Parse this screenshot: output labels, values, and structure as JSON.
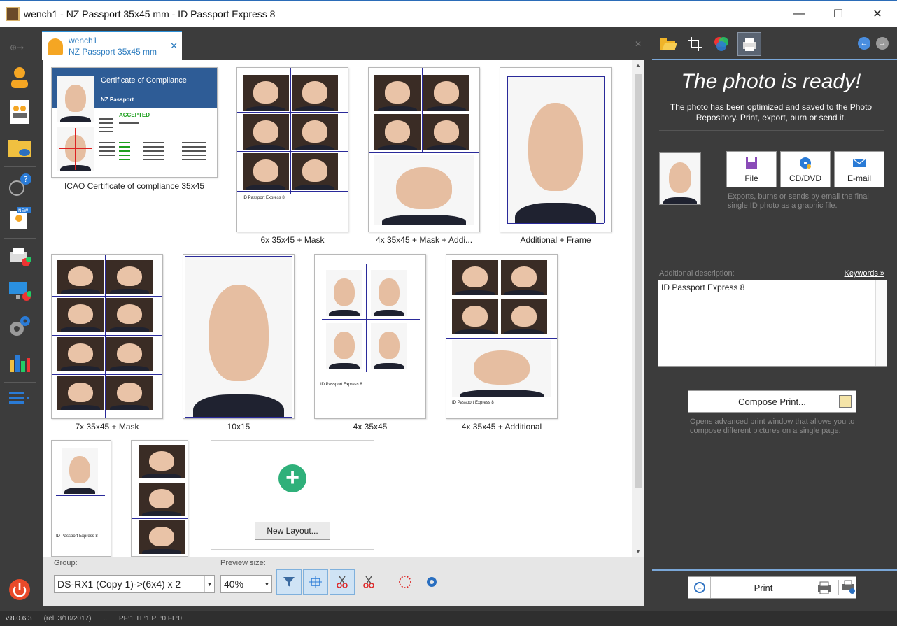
{
  "window": {
    "title": "wench1 - NZ Passport 35x45 mm - ID Passport Express 8",
    "minimize": "—",
    "maximize": "☐",
    "close": "✕"
  },
  "tab": {
    "line1": "wench1",
    "line2": "NZ Passport 35x45 mm",
    "close": "✕"
  },
  "layouts": [
    {
      "caption": "ICAO Certificate of compliance 35x45"
    },
    {
      "caption": "6x 35x45 + Mask"
    },
    {
      "caption": "4x 35x45 + Mask + Addi..."
    },
    {
      "caption": "Additional + Frame"
    },
    {
      "caption": "7x 35x45 + Mask"
    },
    {
      "caption": "10x15"
    },
    {
      "caption": "4x 35x45"
    },
    {
      "caption": "4x 35x45 + Additional"
    }
  ],
  "certificate": {
    "title": "Certificate of Compliance",
    "subtitle": "NZ Passport",
    "status": "ACCEPTED"
  },
  "print_label_small": "ID Passport Express 8",
  "new_layout_button": "New Layout...",
  "bottom_toolbar": {
    "group_label": "Group:",
    "group_value": "DS-RX1 (Copy 1)->(6x4) x 2",
    "preview_label": "Preview size:",
    "preview_value": "40%"
  },
  "right_panel": {
    "title": "The photo is ready!",
    "text": "The photo has been optimized and saved to the Photo Repository. Print, export, burn or send it.",
    "export_buttons": [
      "File",
      "CD/DVD",
      "E-mail"
    ],
    "export_note": "Exports, burns or sends by email the final single ID photo as a graphic file.",
    "additional_description_label": "Additional description:",
    "keywords_link": "Keywords »",
    "description_value": "ID Passport Express 8",
    "compose_button": "Compose Print...",
    "compose_note": "Opens advanced print window that allows you to compose different pictures on a single page.",
    "print_button": "Print"
  },
  "status_bar": {
    "version": "v.8.0.6.3",
    "release": "(rel. 3/10/2017)",
    "dots": "..",
    "counters": "PF:1 TL:1 PL:0 FL:0"
  },
  "colors": {
    "accent_blue": "#2d8fd6",
    "dark_bg": "#3c3c3c",
    "cert_header": "#2e5c96",
    "accepted_green": "#1fa01f",
    "add_button_green": "#2fb07a"
  }
}
